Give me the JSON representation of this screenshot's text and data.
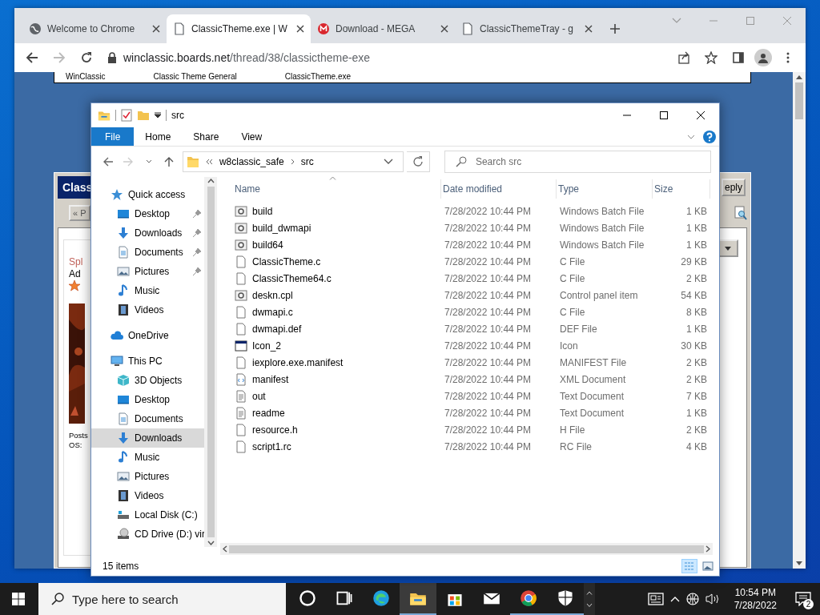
{
  "browser": {
    "tabs": [
      {
        "title": "Welcome to Chrome",
        "kind": "globe",
        "selected": false
      },
      {
        "title": "ClassicTheme.exe | W",
        "kind": "page",
        "selected": true
      },
      {
        "title": "Download - MEGA",
        "kind": "mega",
        "selected": false
      },
      {
        "title": "ClassicThemeTray - g",
        "kind": "page",
        "selected": false
      }
    ],
    "address": {
      "host": "winclassic.boards.net",
      "path": "/thread/38/classictheme-exe"
    }
  },
  "webpage": {
    "breadcrumbs": [
      "WinClassic",
      "Classic Theme General",
      "ClassicTheme.exe"
    ],
    "board_title": "Class",
    "reply_button": "eply",
    "nav_button": "« P",
    "post": {
      "author": "Spl",
      "rank": "Ad",
      "stats": [
        "Posts",
        "OS:"
      ]
    }
  },
  "explorer": {
    "title": "src",
    "ribbon_tabs": [
      {
        "label": "File",
        "kind": "menu"
      },
      {
        "label": "Home",
        "kind": "tab"
      },
      {
        "label": "Share",
        "kind": "tab"
      },
      {
        "label": "View",
        "kind": "tab"
      }
    ],
    "path": [
      "w8classic_safe",
      "src"
    ],
    "search": {
      "placeholder": "Search src"
    },
    "nav": [
      {
        "label": "Quick access",
        "kind": "star",
        "children": [
          {
            "label": "Desktop",
            "kind": "desktop",
            "pinned": true,
            "selected": false
          },
          {
            "label": "Downloads",
            "kind": "download",
            "pinned": true,
            "selected": false
          },
          {
            "label": "Documents",
            "kind": "document",
            "pinned": true,
            "selected": false
          },
          {
            "label": "Pictures",
            "kind": "pictures",
            "pinned": true,
            "selected": false
          },
          {
            "label": "Music",
            "kind": "music",
            "pinned": false,
            "selected": false
          },
          {
            "label": "Videos",
            "kind": "videos",
            "pinned": false,
            "selected": false
          }
        ]
      },
      {
        "label": "OneDrive",
        "kind": "cloud"
      },
      {
        "label": "This PC",
        "kind": "pc",
        "children": [
          {
            "label": "3D Objects",
            "kind": "cube",
            "pinned": false,
            "selected": false
          },
          {
            "label": "Desktop",
            "kind": "desktop",
            "pinned": false,
            "selected": false
          },
          {
            "label": "Documents",
            "kind": "document",
            "pinned": false,
            "selected": false
          },
          {
            "label": "Downloads",
            "kind": "download",
            "pinned": false,
            "selected": true
          },
          {
            "label": "Music",
            "kind": "music",
            "pinned": false,
            "selected": false
          },
          {
            "label": "Pictures",
            "kind": "pictures",
            "pinned": false,
            "selected": false
          },
          {
            "label": "Videos",
            "kind": "videos",
            "pinned": false,
            "selected": false
          },
          {
            "label": "Local Disk (C:)",
            "kind": "disk",
            "pinned": false,
            "selected": false
          },
          {
            "label": "CD Drive (D:) vir",
            "kind": "cd",
            "pinned": false,
            "selected": false
          }
        ]
      }
    ],
    "columns": [
      "Name",
      "Date modified",
      "Type",
      "Size"
    ],
    "files": [
      {
        "name": "build",
        "date": "7/28/2022 10:44 PM",
        "type": "Windows Batch File",
        "size": "1 KB",
        "kind": "batch"
      },
      {
        "name": "build_dwmapi",
        "date": "7/28/2022 10:44 PM",
        "type": "Windows Batch File",
        "size": "1 KB",
        "kind": "batch"
      },
      {
        "name": "build64",
        "date": "7/28/2022 10:44 PM",
        "type": "Windows Batch File",
        "size": "1 KB",
        "kind": "batch"
      },
      {
        "name": "ClassicTheme.c",
        "date": "7/28/2022 10:44 PM",
        "type": "C File",
        "size": "29 KB",
        "kind": "file"
      },
      {
        "name": "ClassicTheme64.c",
        "date": "7/28/2022 10:44 PM",
        "type": "C File",
        "size": "2 KB",
        "kind": "file"
      },
      {
        "name": "deskn.cpl",
        "date": "7/28/2022 10:44 PM",
        "type": "Control panel item",
        "size": "54 KB",
        "kind": "batch"
      },
      {
        "name": "dwmapi.c",
        "date": "7/28/2022 10:44 PM",
        "type": "C File",
        "size": "8 KB",
        "kind": "file"
      },
      {
        "name": "dwmapi.def",
        "date": "7/28/2022 10:44 PM",
        "type": "DEF File",
        "size": "1 KB",
        "kind": "file"
      },
      {
        "name": "Icon_2",
        "date": "7/28/2022 10:44 PM",
        "type": "Icon",
        "size": "30 KB",
        "kind": "window"
      },
      {
        "name": "iexplore.exe.manifest",
        "date": "7/28/2022 10:44 PM",
        "type": "MANIFEST File",
        "size": "2 KB",
        "kind": "file"
      },
      {
        "name": "manifest",
        "date": "7/28/2022 10:44 PM",
        "type": "XML Document",
        "size": "2 KB",
        "kind": "xml"
      },
      {
        "name": "out",
        "date": "7/28/2022 10:44 PM",
        "type": "Text Document",
        "size": "7 KB",
        "kind": "text"
      },
      {
        "name": "readme",
        "date": "7/28/2022 10:44 PM",
        "type": "Text Document",
        "size": "1 KB",
        "kind": "text"
      },
      {
        "name": "resource.h",
        "date": "7/28/2022 10:44 PM",
        "type": "H File",
        "size": "2 KB",
        "kind": "file"
      },
      {
        "name": "script1.rc",
        "date": "7/28/2022 10:44 PM",
        "type": "RC File",
        "size": "4 KB",
        "kind": "file"
      }
    ],
    "status": "15 items"
  },
  "taskbar": {
    "search": {
      "placeholder": "Type here to search"
    },
    "apps": [
      {
        "kind": "cortana",
        "active": false,
        "running": false
      },
      {
        "kind": "taskview",
        "active": false,
        "running": false
      },
      {
        "kind": "edge",
        "active": false,
        "running": false
      },
      {
        "kind": "explorer",
        "active": true,
        "running": true
      },
      {
        "kind": "store",
        "active": false,
        "running": false
      },
      {
        "kind": "mail",
        "active": false,
        "running": false
      },
      {
        "kind": "chrome",
        "active": false,
        "running": true
      },
      {
        "kind": "shield",
        "active": false,
        "running": true
      }
    ],
    "time": "10:54 PM",
    "date": "7/28/2022",
    "notifications": "2"
  }
}
